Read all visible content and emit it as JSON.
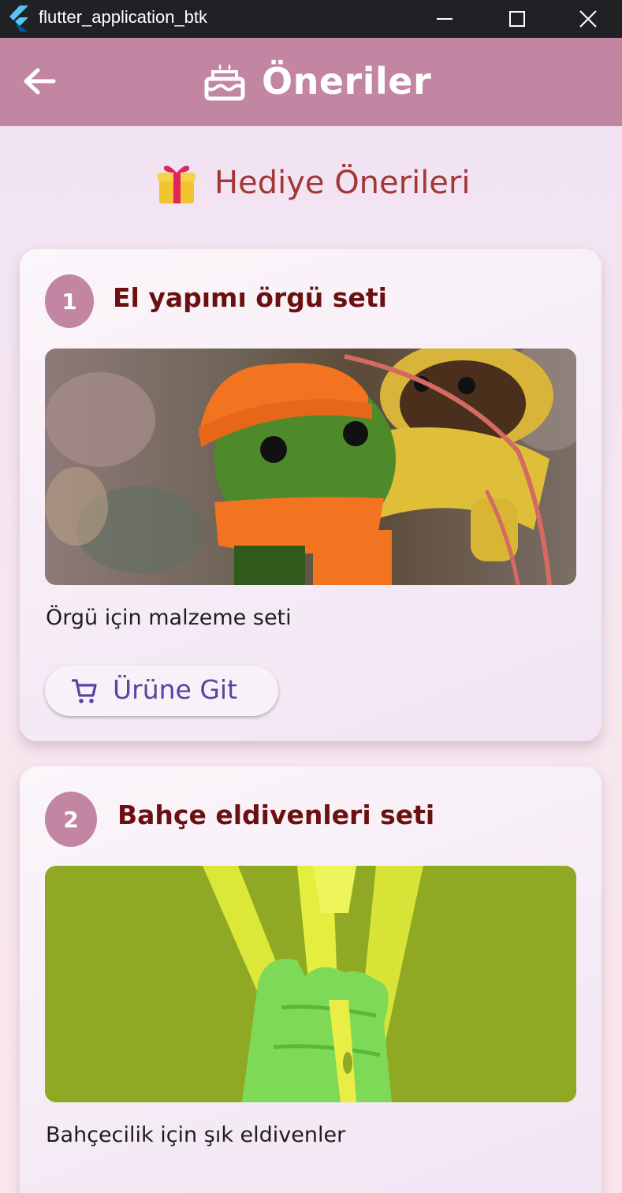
{
  "window": {
    "title": "flutter_application_btk",
    "icons": {
      "app": "flutter-logo-icon",
      "minimize": "minimize-icon",
      "maximize": "maximize-icon",
      "close": "close-icon"
    }
  },
  "appbar": {
    "back_icon": "arrow-back-icon",
    "title_icon": "cake-icon",
    "title": "Öneriler",
    "color": "#c285a2"
  },
  "section": {
    "icon": "gift-emoji",
    "title": "Hediye Önerileri",
    "title_color": "#a33737"
  },
  "cards": [
    {
      "number": "1",
      "title": "El yapımı örgü seti",
      "description": "Örgü için malzeme seti",
      "image": "knitted-dolls-photo",
      "button": {
        "icon": "cart-icon",
        "label": "Ürüne Git"
      }
    },
    {
      "number": "2",
      "title": "Bahçe eldivenleri seti",
      "description": "Bahçecilik için şık eldivenler",
      "image": "garden-glove-photo"
    }
  ],
  "colors": {
    "title_text": "#6b1010",
    "button_text": "#5a44a0",
    "badge": "#c285a2"
  }
}
